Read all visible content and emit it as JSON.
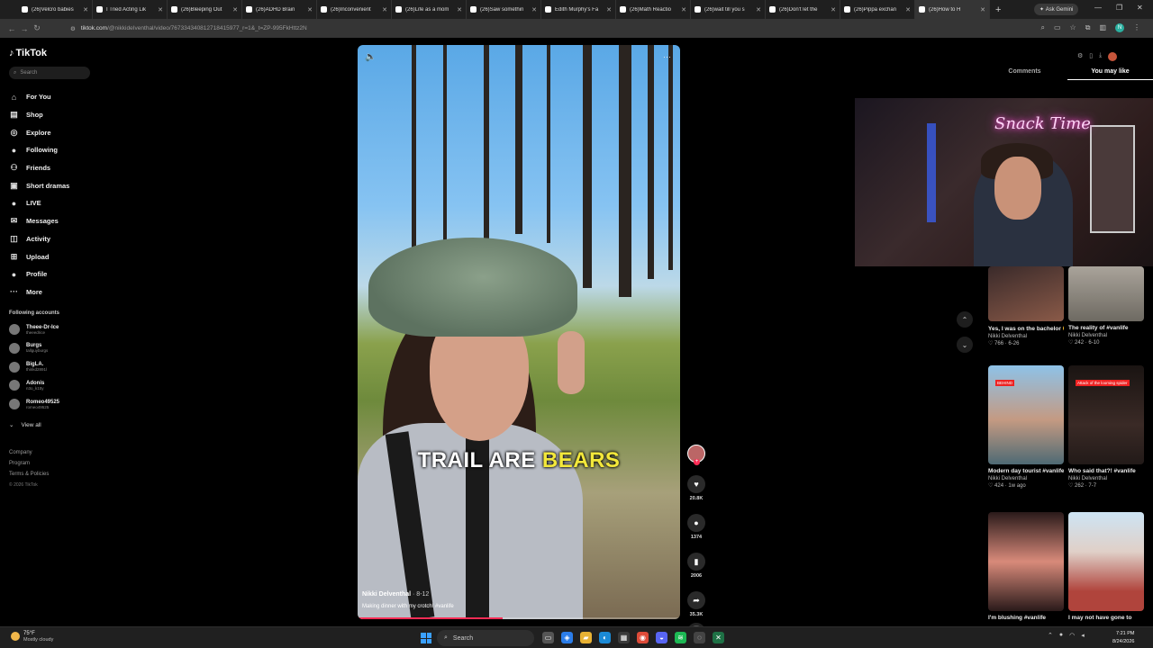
{
  "browser": {
    "tabs": [
      {
        "label": "(26)Velcro babies",
        "active": false
      },
      {
        "label": "I Tried Acting Lik",
        "active": false
      },
      {
        "label": "(26)Bleeping Out",
        "active": false
      },
      {
        "label": "(26)ADHD Brain",
        "active": false
      },
      {
        "label": "(26)Inconvenient",
        "active": false
      },
      {
        "label": "(26)Life as a mom",
        "active": false
      },
      {
        "label": "(26)Saw somethin",
        "active": false
      },
      {
        "label": "Edith Murphy's Fa",
        "active": false
      },
      {
        "label": "(26)Math Reactio",
        "active": false
      },
      {
        "label": "(26)wait till you s",
        "active": false
      },
      {
        "label": "(26)Don't let the",
        "active": false
      },
      {
        "label": "(26)Pippa exchan",
        "active": false
      },
      {
        "label": "(26)How to H",
        "active": true
      }
    ],
    "ask_gemini": "Ask Gemini",
    "url_host": "tiktok.com",
    "url_path": "/@nikkideIventhal/video/767334340812718415977_r=1&_t=ZP-995FkHttz2N"
  },
  "sidebar": {
    "logo": "TikTok",
    "search_placeholder": "Search",
    "nav": [
      {
        "label": "For You",
        "icon": "home-icon",
        "glyph": "⌂"
      },
      {
        "label": "Shop",
        "icon": "shop-icon",
        "glyph": "▤"
      },
      {
        "label": "Explore",
        "icon": "compass-icon",
        "glyph": "◎"
      },
      {
        "label": "Following",
        "icon": "following-icon",
        "glyph": "●"
      },
      {
        "label": "Friends",
        "icon": "friends-icon",
        "glyph": "⚇"
      },
      {
        "label": "Short dramas",
        "icon": "film-icon",
        "glyph": "▣"
      },
      {
        "label": "LIVE",
        "icon": "live-icon",
        "glyph": "●"
      },
      {
        "label": "Messages",
        "icon": "messages-icon",
        "glyph": "✉"
      },
      {
        "label": "Activity",
        "icon": "activity-icon",
        "glyph": "◫"
      },
      {
        "label": "Upload",
        "icon": "upload-icon",
        "glyph": "⊞"
      },
      {
        "label": "Profile",
        "icon": "profile-icon",
        "glyph": "●"
      },
      {
        "label": "More",
        "icon": "more-icon",
        "glyph": "···"
      }
    ],
    "following_title": "Following accounts",
    "accounts": [
      {
        "name": "Theee-Dr-Ice",
        "handle": "theeedrice"
      },
      {
        "name": "Burgs",
        "handle": "tallguyburgs"
      },
      {
        "name": "BigLA.",
        "handle": "thinkd2891l"
      },
      {
        "name": "Adonis",
        "handle": "n3o_k1tty"
      },
      {
        "name": "Romeo49525",
        "handle": "romeo49525"
      }
    ],
    "view_all": "View all",
    "footer": [
      "Company",
      "Program",
      "Terms & Policies"
    ],
    "copyright": "© 2026 TikTok"
  },
  "video": {
    "caption_part1": "TRAIL ARE",
    "caption_part2": "BEARS",
    "author": "Nikki Delventhal",
    "date": "· 8-12",
    "description": "Making dinner with my crotch! #vanlife",
    "progress": 0.45
  },
  "actions": {
    "likes": "20.8K",
    "comments": "1374",
    "saves": "2006",
    "shares": "35.3K"
  },
  "right_panel": {
    "tabs": [
      "Comments",
      "You may like"
    ],
    "active_tab": 1,
    "webcam_sign": "Snack Time",
    "cards": [
      {
        "title": "Yes, I was on the bachelor 😀 ...",
        "author": "Nikki Delventhal",
        "likes": "766",
        "date": "6-26"
      },
      {
        "title": "The reality of #vanlife",
        "author": "Nikki Delventhal",
        "likes": "242",
        "date": "6-10"
      },
      {
        "title": "Modern day tourist #vanlife",
        "author": "Nikki Delventhal",
        "likes": "424",
        "date": "1w ago",
        "tag": "BEHIND"
      },
      {
        "title": "Who said that?! #vanlife",
        "author": "Nikki Delventhal",
        "likes": "262",
        "date": "7-7",
        "tag": "Attack of the looming spider"
      },
      {
        "title": "I'm blushing #vanlife",
        "author": "",
        "likes": "",
        "date": ""
      },
      {
        "title": "I may not have gone to",
        "author": "",
        "likes": "",
        "date": ""
      }
    ]
  },
  "taskbar": {
    "temp": "75°F",
    "weather": "Mostly cloudy",
    "search": "Search",
    "time": "7:21 PM",
    "date": "8/24/2026"
  }
}
